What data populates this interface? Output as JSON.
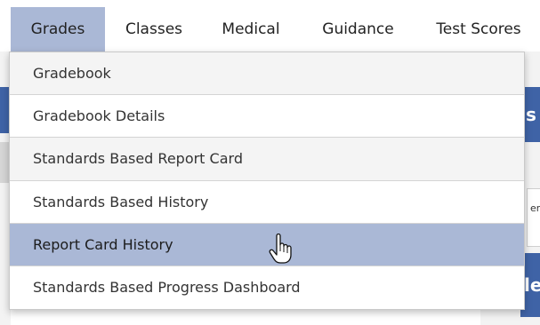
{
  "nav": {
    "tabs": [
      {
        "label": "Grades",
        "active": true
      },
      {
        "label": "Classes",
        "active": false
      },
      {
        "label": "Medical",
        "active": false
      },
      {
        "label": "Guidance",
        "active": false
      },
      {
        "label": "Test Scores",
        "active": false
      }
    ]
  },
  "dropdown": {
    "items": [
      {
        "label": "Gradebook",
        "highlighted": false
      },
      {
        "label": "Gradebook Details",
        "highlighted": false
      },
      {
        "label": "Standards Based Report Card",
        "highlighted": false
      },
      {
        "label": "Standards Based History",
        "highlighted": false
      },
      {
        "label": "Report Card History",
        "highlighted": true
      },
      {
        "label": "Standards Based Progress Dashboard",
        "highlighted": false
      }
    ]
  },
  "background": {
    "right_header_fragment": "s",
    "right_input_fragment": "en",
    "right_button_fragment": "le"
  },
  "cursor": {
    "icon": "hand-pointer-icon"
  },
  "colors": {
    "active_tab": "#aab8d6",
    "highlight_item": "#aab8d6",
    "brand_blue": "#3f63a6",
    "text": "#333333"
  }
}
